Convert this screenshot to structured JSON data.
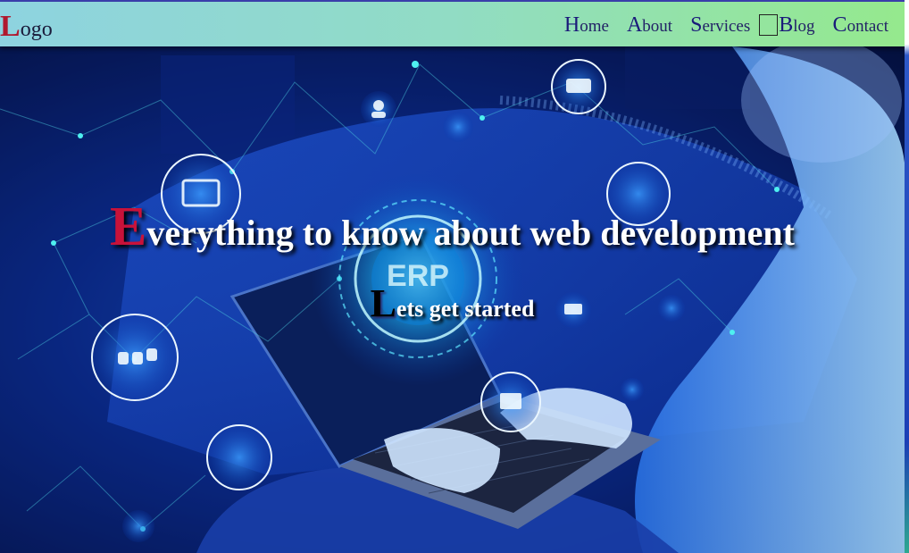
{
  "logo": {
    "initial": "L",
    "rest": "ogo"
  },
  "nav": {
    "items": [
      {
        "initial": "H",
        "rest": "ome",
        "boxed": false
      },
      {
        "initial": "A",
        "rest": "bout",
        "boxed": false
      },
      {
        "initial": "S",
        "rest": "ervices",
        "boxed": false
      },
      {
        "initial": "B",
        "rest": "log",
        "boxed": true
      },
      {
        "initial": "C",
        "rest": "ontact",
        "boxed": false
      }
    ]
  },
  "hero": {
    "title_initial": "E",
    "title_rest": "verything to know about web development",
    "subtitle_initial": "L",
    "subtitle_rest": "ets get started",
    "image_badge": "ERP"
  },
  "colors": {
    "nav_gradient_start": "#8ed3e0",
    "nav_gradient_end": "#95e98d",
    "accent_red": "#c8123a",
    "nav_text": "#222266",
    "hero_blue": "#0c2f9a"
  }
}
